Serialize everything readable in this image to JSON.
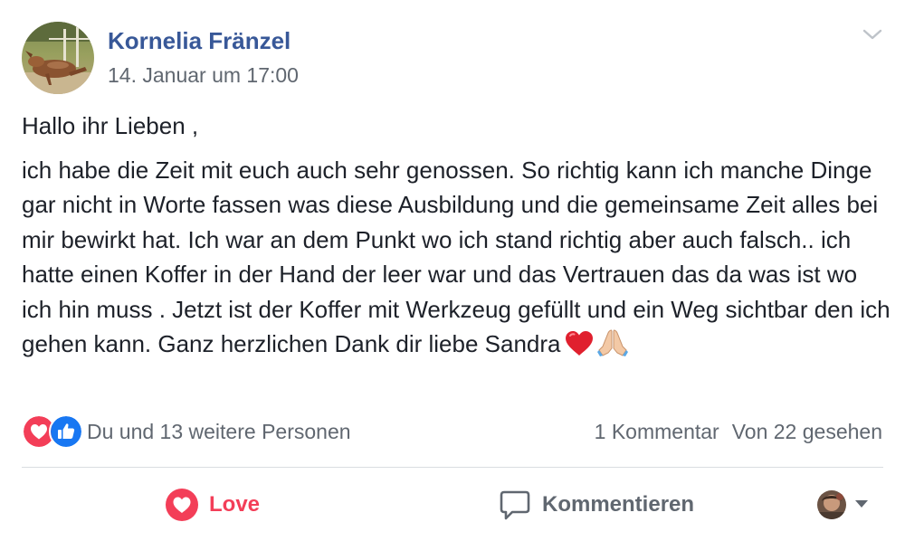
{
  "post": {
    "author": "Kornelia Fränzel",
    "timestamp": "14. Januar um 17:00",
    "greeting": "Hallo ihr Lieben ,",
    "body": "ich habe die Zeit mit euch auch sehr genossen. So richtig kann ich manche Dinge gar nicht in Worte fassen was diese Ausbildung und die gemeinsame Zeit alles bei mir bewirkt hat. Ich war an dem Punkt wo ich stand richtig aber auch falsch.. ich hatte einen Koffer in der Hand der leer war und das Vertrauen das da was ist wo ich hin muss . Jetzt ist der Koffer mit Werkzeug gefüllt und ein Weg sichtbar den ich gehen kann. Ganz herzlichen Dank dir liebe Sandra",
    "emojis": [
      "heart-emoji",
      "folded-hands-emoji"
    ]
  },
  "reactions": {
    "icons": [
      "love-reaction-icon",
      "like-reaction-icon"
    ],
    "summary": "Du und 13 weitere Personen"
  },
  "stats": {
    "comments": "1 Kommentar",
    "views": "Von 22 gesehen"
  },
  "actions": {
    "love_label": "Love",
    "comment_label": "Kommentieren"
  },
  "colors": {
    "name_link": "#385898",
    "secondary_text": "#606770",
    "love_red": "#f33e58",
    "like_blue": "#1877f2",
    "divider": "#dadde1"
  }
}
